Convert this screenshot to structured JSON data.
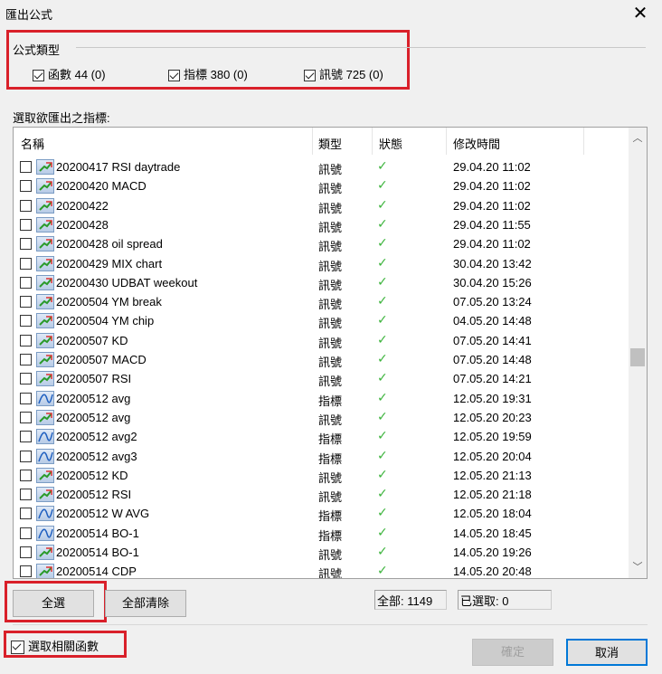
{
  "window": {
    "title": "匯出公式",
    "close_icon": "close-icon"
  },
  "formula_type": {
    "label": "公式類型",
    "options": [
      {
        "label": "函數 44 (0)",
        "checked": true
      },
      {
        "label": "指標 380 (0)",
        "checked": true
      },
      {
        "label": "訊號 725 (0)",
        "checked": true
      }
    ]
  },
  "select_label": "選取欲匯出之指標:",
  "columns": [
    "名稱",
    "類型",
    "狀態",
    "修改時間"
  ],
  "rows": [
    {
      "name": "20200417 RSI daytrade",
      "type": "訊號",
      "time": "29.04.20 11:02"
    },
    {
      "name": "20200420 MACD",
      "type": "訊號",
      "time": "29.04.20 11:02"
    },
    {
      "name": "20200422",
      "type": "訊號",
      "time": "29.04.20 11:02"
    },
    {
      "name": "20200428",
      "type": "訊號",
      "time": "29.04.20 11:55"
    },
    {
      "name": "20200428 oil spread",
      "type": "訊號",
      "time": "29.04.20 11:02"
    },
    {
      "name": "20200429 MIX chart",
      "type": "訊號",
      "time": "30.04.20 13:42"
    },
    {
      "name": "20200430 UDBAT weekout",
      "type": "訊號",
      "time": "30.04.20 15:26"
    },
    {
      "name": "20200504 YM break",
      "type": "訊號",
      "time": "07.05.20 13:24"
    },
    {
      "name": "20200504 YM chip",
      "type": "訊號",
      "time": "04.05.20 14:48"
    },
    {
      "name": "20200507 KD",
      "type": "訊號",
      "time": "07.05.20 14:41"
    },
    {
      "name": "20200507 MACD",
      "type": "訊號",
      "time": "07.05.20 14:48"
    },
    {
      "name": "20200507 RSI",
      "type": "訊號",
      "time": "07.05.20 14:21"
    },
    {
      "name": "20200512  avg",
      "type": "指標",
      "time": "12.05.20 19:31"
    },
    {
      "name": "20200512 avg",
      "type": "訊號",
      "time": "12.05.20 20:23"
    },
    {
      "name": "20200512 avg2",
      "type": "指標",
      "time": "12.05.20 19:59"
    },
    {
      "name": "20200512 avg3",
      "type": "指標",
      "time": "12.05.20 20:04"
    },
    {
      "name": "20200512 KD",
      "type": "訊號",
      "time": "12.05.20 21:13"
    },
    {
      "name": "20200512 RSI",
      "type": "訊號",
      "time": "12.05.20 21:18"
    },
    {
      "name": "20200512 W AVG",
      "type": "指標",
      "time": "12.05.20 18:04"
    },
    {
      "name": "20200514 BO-1",
      "type": "指標",
      "time": "14.05.20 18:45"
    },
    {
      "name": "20200514 BO-1",
      "type": "訊號",
      "time": "14.05.20 19:26"
    },
    {
      "name": "20200514 CDP",
      "type": "訊號",
      "time": "14.05.20 20:48"
    }
  ],
  "status_glyph": "✓",
  "buttons": {
    "select_all": "全選",
    "clear_all": "全部清除",
    "ok": "確定",
    "cancel": "取消"
  },
  "stats": {
    "total": "全部: 1149",
    "selected": "已選取: 0"
  },
  "select_related": {
    "label": "選取相關函數",
    "checked": true
  },
  "colors": {
    "highlight": "#d9202a",
    "check": "#3cb43c",
    "default_button_border": "#0078d7"
  }
}
